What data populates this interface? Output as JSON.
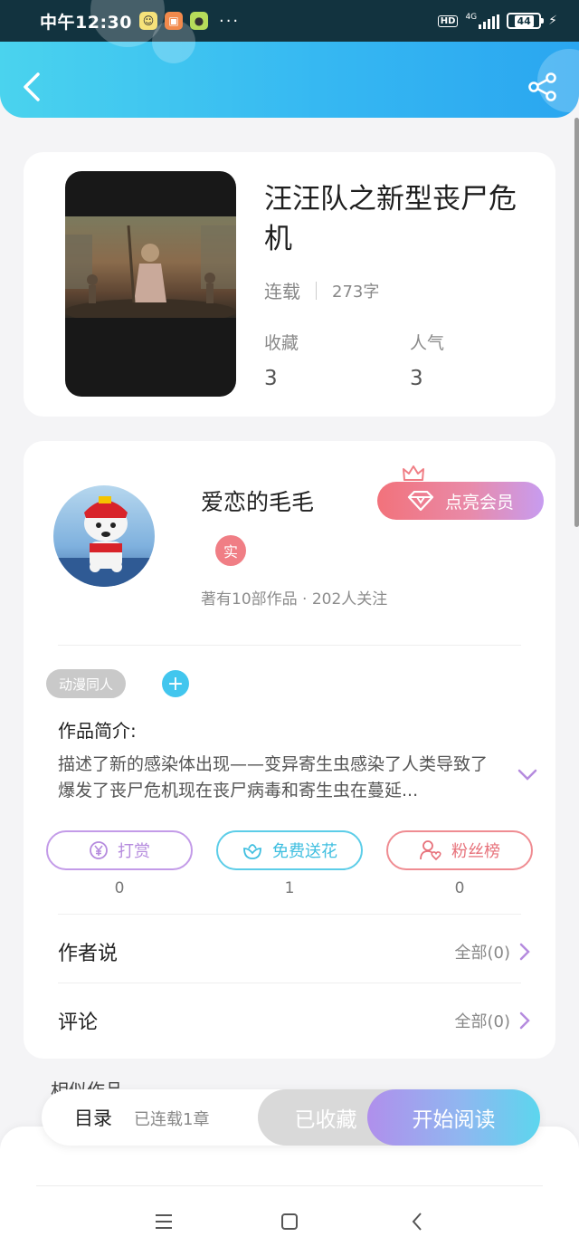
{
  "status_bar": {
    "time": "中午12:30",
    "network": "4G",
    "hd": "HD",
    "battery": "44",
    "more": "···"
  },
  "header": {
    "back_icon": "back-arrow-icon",
    "share_icon": "share-icon",
    "gradient_colors": [
      "#4ad3ee",
      "#2aa6f0"
    ]
  },
  "book": {
    "title": "汪汪队之新型丧尸危机",
    "status": "连载",
    "word_count": "273字",
    "favorites_label": "收藏",
    "favorites_value": "3",
    "popularity_label": "人气",
    "popularity_value": "3"
  },
  "author": {
    "name": "爱恋的毛毛",
    "real_badge": "实",
    "stats": "著有10部作品 · 202人关注",
    "vip_button": "点亮会员"
  },
  "work": {
    "tag": "动漫同人",
    "add_tag": "+",
    "intro_label": "作品简介:",
    "intro_text": "描述了新的感染体出现——变异寄生虫感染了人类导致了爆发了丧尸危机现在丧尸病毒和寄生虫在蔓延..."
  },
  "actions": {
    "reward_label": "打赏",
    "reward_count": "0",
    "flower_label": "免费送花",
    "flower_count": "1",
    "fans_label": "粉丝榜",
    "fans_count": "0"
  },
  "sections": {
    "author_says": "作者说",
    "author_says_more": "全部(0)",
    "comments": "评论",
    "comments_more": "全部(0)",
    "similar": "相似作品"
  },
  "bottom_bar": {
    "toc": "目录",
    "serial": "已连载1章",
    "collected": "已收藏",
    "read": "开始阅读"
  },
  "colors": {
    "accent_blue": "#42c6ee",
    "accent_purple": "#b58bde",
    "accent_red": "#e7727b"
  }
}
